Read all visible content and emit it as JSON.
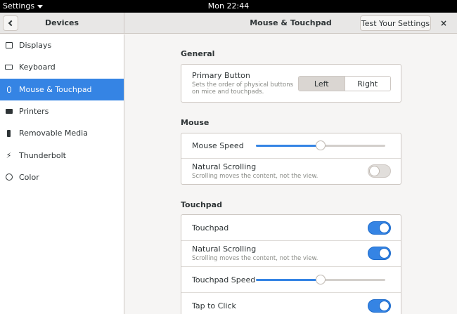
{
  "topbar": {
    "app_menu": "Settings",
    "clock": "Mon 22:44"
  },
  "header": {
    "sidebar_title": "Devices",
    "title": "Mouse & Touchpad",
    "test_button": "Test Your Settings",
    "close_glyph": "×"
  },
  "sidebar": {
    "items": [
      {
        "label": "Displays",
        "icon": "display-icon"
      },
      {
        "label": "Keyboard",
        "icon": "keyboard-icon"
      },
      {
        "label": "Mouse & Touchpad",
        "icon": "mouse-icon",
        "active": true
      },
      {
        "label": "Printers",
        "icon": "printer-icon"
      },
      {
        "label": "Removable Media",
        "icon": "usb-icon"
      },
      {
        "label": "Thunderbolt",
        "icon": "thunderbolt-icon"
      },
      {
        "label": "Color",
        "icon": "color-icon"
      }
    ]
  },
  "general": {
    "title": "General",
    "primary_button": {
      "label": "Primary Button",
      "description_line1": "Sets the order of physical buttons",
      "description_line2": "on mice and touchpads.",
      "options": [
        "Left",
        "Right"
      ],
      "selected": "Left"
    }
  },
  "mouse": {
    "title": "Mouse",
    "speed": {
      "label": "Mouse Speed",
      "value": 0.5
    },
    "natural_scrolling": {
      "label": "Natural Scrolling",
      "description": "Scrolling moves the content, not the view.",
      "enabled": false
    }
  },
  "touchpad": {
    "title": "Touchpad",
    "touchpad": {
      "label": "Touchpad",
      "enabled": true
    },
    "natural_scrolling": {
      "label": "Natural Scrolling",
      "description": "Scrolling moves the content, not the view.",
      "enabled": true
    },
    "speed": {
      "label": "Touchpad Speed",
      "value": 0.5
    },
    "tap_to_click": {
      "label": "Tap to Click",
      "enabled": true
    }
  },
  "colors": {
    "accent": "#3584e4",
    "sidebar_bg": "#ffffff",
    "content_bg": "#f6f5f4"
  }
}
